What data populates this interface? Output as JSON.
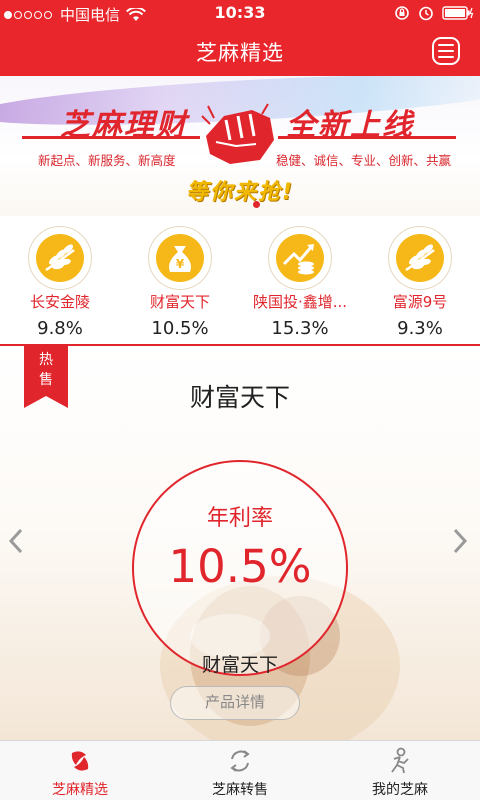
{
  "status_bar": {
    "carrier": "中国电信",
    "time": "10:33"
  },
  "header": {
    "title": "芝麻精选"
  },
  "banner": {
    "title_left": "芝麻理财",
    "title_right": "全新上线",
    "subtitle_left": "新起点、新服务、新高度",
    "subtitle_right": "稳健、诚信、专业、创新、共赢",
    "cta": "等你来抢!"
  },
  "products": [
    {
      "name": "长安金陵",
      "rate": "9.8%",
      "icon": "wheat-icon"
    },
    {
      "name": "财富天下",
      "rate": "10.5%",
      "icon": "money-bag-icon"
    },
    {
      "name": "陕国投·鑫增...",
      "rate": "15.3%",
      "icon": "growth-chart-icon"
    },
    {
      "name": "富源9号",
      "rate": "9.3%",
      "icon": "wheat-icon"
    }
  ],
  "featured": {
    "tag": "热售",
    "title": "财富天下",
    "rate_label": "年利率",
    "rate_value": "10.5%",
    "name": "财富天下",
    "detail_button": "产品详情"
  },
  "tabbar": {
    "items": [
      {
        "label": "芝麻精选",
        "icon": "home-icon",
        "active": true
      },
      {
        "label": "芝麻转售",
        "icon": "transfer-icon",
        "active": false
      },
      {
        "label": "我的芝麻",
        "icon": "profile-icon",
        "active": false
      }
    ]
  },
  "colors": {
    "brand_red": "#e8262c",
    "accent_gold": "#f0b800"
  }
}
